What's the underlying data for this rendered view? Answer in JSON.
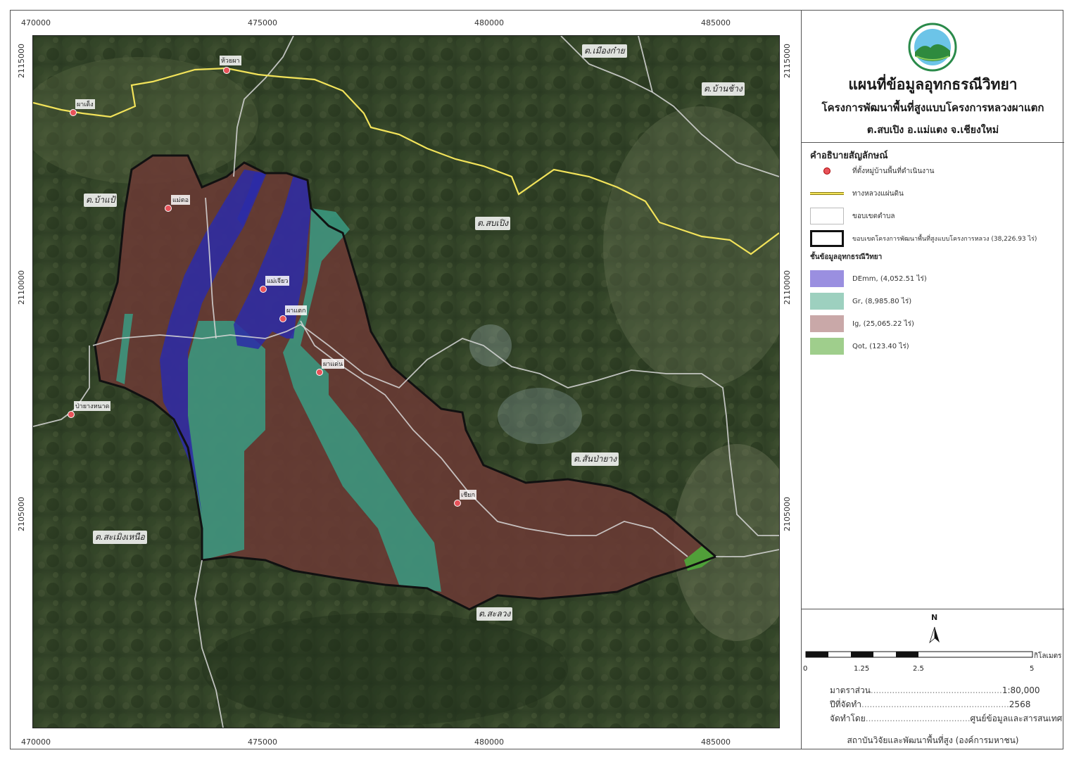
{
  "map": {
    "x_ticks": [
      "470000",
      "475000",
      "480000",
      "485000"
    ],
    "y_ticks": [
      "2115000",
      "2110000",
      "2105000"
    ],
    "places": [
      {
        "name": "ต.เมืองก๋าย"
      },
      {
        "name": "ต.บ้านช้าง"
      },
      {
        "name": "ต.บ้าแป้"
      },
      {
        "name": "ต.สบเปิง"
      },
      {
        "name": "ต.สันป่ายาง"
      },
      {
        "name": "ต.สะเมิงเหนือ"
      },
      {
        "name": "ต.สะลวง"
      }
    ],
    "villages": [
      {
        "name": "ห้วยผา"
      },
      {
        "name": "ผาเด็ง"
      },
      {
        "name": "แม่ตอ"
      },
      {
        "name": "แม่เจียว"
      },
      {
        "name": "ผาแตก"
      },
      {
        "name": "ผาแด่น"
      },
      {
        "name": "ป่ายางหนาด"
      },
      {
        "name": "เชียก"
      }
    ]
  },
  "title": {
    "main": "แผนที่ข้อมูลอุทกธรณีวิทยา",
    "sub": "โครงการพัฒนาพื้นที่สูงแบบโครงการหลวงผาแตก",
    "location": "ต.สบเปิง อ.แม่แตง จ.เชียงใหม่"
  },
  "legend": {
    "title": "คำอธิบายสัญลักษณ์",
    "items": [
      {
        "label": "ที่ตั้งหมู่บ้านพื้นที่ดำเนินงาน"
      },
      {
        "label": "ทางหลวงแผ่นดิน"
      },
      {
        "label": "ขอบเขตตำบล"
      },
      {
        "label": "ขอบเขตโครงการพัฒนาพื้นที่สูงแบบโครงการหลวง (38,226.93 ไร่)"
      }
    ],
    "geo_title": "ชั้นข้อมูลอุทกธรณีวิทยา",
    "geo_items": [
      {
        "label": "DEmm, (4,052.51 ไร่)",
        "color": "#9a8fe0"
      },
      {
        "label": "Gr, (8,985.80 ไร่)",
        "color": "#9dd0bf"
      },
      {
        "label": "Ig, (25,065.22 ไร่)",
        "color": "#c9a8a8"
      },
      {
        "label": "Qot, (123.40 ไร่)",
        "color": "#9fce8c"
      }
    ]
  },
  "north_label": "N",
  "scalebar": {
    "labels": [
      "0",
      "1.25",
      "2.5",
      "5"
    ],
    "unit": "กิโลเมตร"
  },
  "info": {
    "scale_label": "มาตราส่วน",
    "scale_value": "1:80,000",
    "year_label": "ปีที่จัดทำ",
    "year_value": "2568",
    "by_label": "จัดทำโดย",
    "by_value": "ศูนย์ข้อมูลและสารสนเทศ",
    "credit": "สถาบันวิจัยและพัฒนาพื้นที่สูง (องค์การมหาชน)"
  },
  "colors": {
    "demm": "#2b2ba8",
    "gr": "#3a9b82",
    "ig": "#6a3a34",
    "qot": "#4faa3a",
    "highway": "#f2e35a",
    "village": "#e8535a"
  }
}
